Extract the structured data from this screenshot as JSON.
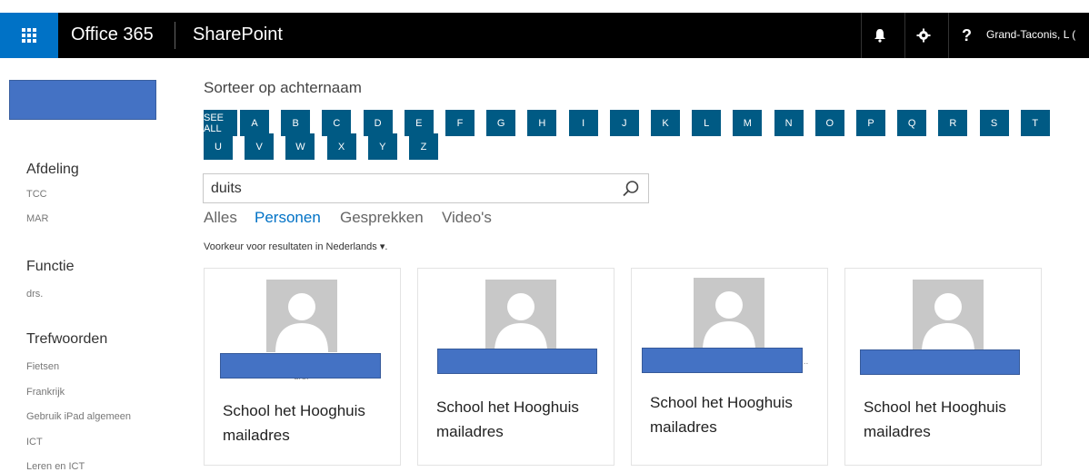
{
  "suite": {
    "brand": "Office 365",
    "app_name": "SharePoint",
    "user_name": "Grand-Taconis, L (",
    "icons": [
      "waffle-icon",
      "bell-icon",
      "gear-icon",
      "help-icon"
    ],
    "help_glyph": "?",
    "bar_color": "#000000",
    "waffle_color": "#0072c6"
  },
  "refiners": {
    "groups": [
      {
        "title": "Afdeling",
        "items": [
          "TCC",
          "MAR"
        ]
      },
      {
        "title": "Functie",
        "items": [
          "drs."
        ]
      },
      {
        "title": "Trefwoorden",
        "items": [
          "Fietsen",
          "Frankrijk",
          "Gebruik iPad algemeen",
          "ICT",
          "Leren en ICT"
        ]
      }
    ]
  },
  "sort": {
    "label": "Sorteer op achternaam",
    "letters": [
      "SEE ALL",
      "A",
      "B",
      "C",
      "D",
      "E",
      "F",
      "G",
      "H",
      "I",
      "J",
      "K",
      "L",
      "M",
      "N",
      "O",
      "P",
      "Q",
      "R",
      "S",
      "T",
      "U",
      "V",
      "W",
      "X",
      "Y",
      "Z"
    ],
    "tile_color": "#005a84"
  },
  "search": {
    "value": "duits"
  },
  "verticals": {
    "items": [
      "Alles",
      "Personen",
      "Gesprekken",
      "Video's"
    ],
    "active": "Personen",
    "active_color": "#0072c6"
  },
  "language_pref": "Voorkeur voor resultaten in Nederlands ▾.",
  "results": [
    {
      "subtitle": "drs.",
      "org": "School het Hooghuis",
      "mail": "mailadres"
    },
    {
      "subtitle": "",
      "org": "School het Hooghuis",
      "mail": "mailadres"
    },
    {
      "subtitle": "...",
      "org": "School het Hooghuis",
      "mail": "mailadres"
    },
    {
      "subtitle": "",
      "org": "School het Hooghuis",
      "mail": "mailadres"
    }
  ],
  "redaction_color": "#4472c4"
}
